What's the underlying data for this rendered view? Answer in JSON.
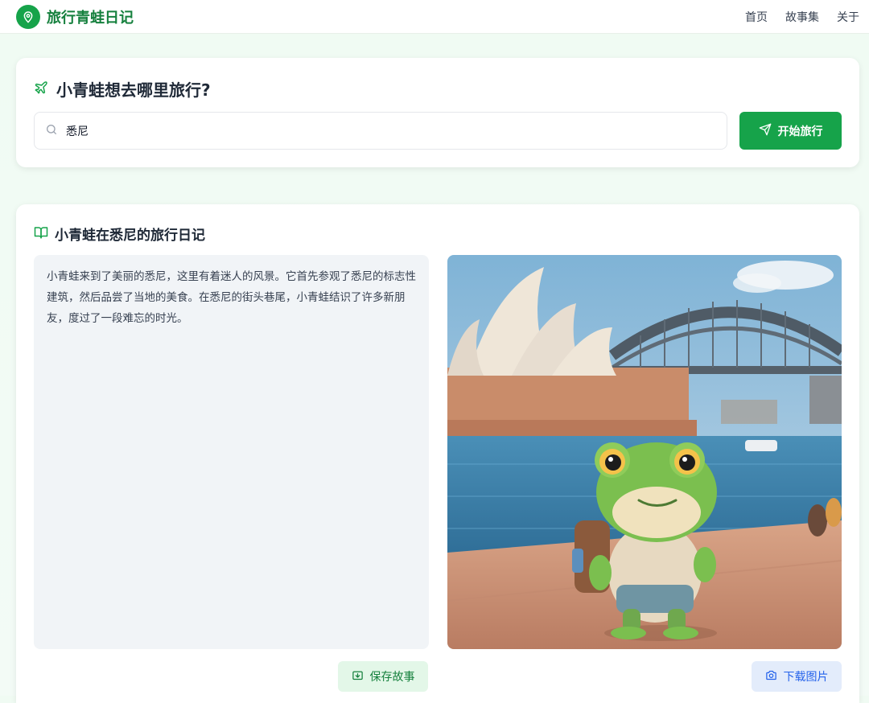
{
  "header": {
    "brand_title": "旅行青蛙日记",
    "brand_icon": "map-pin-icon",
    "nav": [
      {
        "label": "首页"
      },
      {
        "label": "故事集"
      },
      {
        "label": "关于"
      }
    ]
  },
  "search": {
    "heading": "小青蛙想去哪里旅行?",
    "heading_icon": "plane-icon",
    "value": "悉尼",
    "start_label": "开始旅行",
    "start_icon": "send-icon"
  },
  "diary": {
    "heading": "小青蛙在悉尼的旅行日记",
    "heading_icon": "book-open-icon",
    "story": "小青蛙来到了美丽的悉尼，这里有着迷人的风景。它首先参观了悉尼的标志性建筑，然后品尝了当地的美食。在悉尼的街头巷尾，小青蛙结识了许多新朋友，度过了一段难忘的时光。",
    "save_label": "保存故事",
    "save_icon": "save-icon",
    "download_label": "下载图片",
    "download_icon": "camera-icon"
  },
  "colors": {
    "brand_green": "#16a34a",
    "brand_text": "#15803d",
    "download_blue": "#2563eb"
  }
}
